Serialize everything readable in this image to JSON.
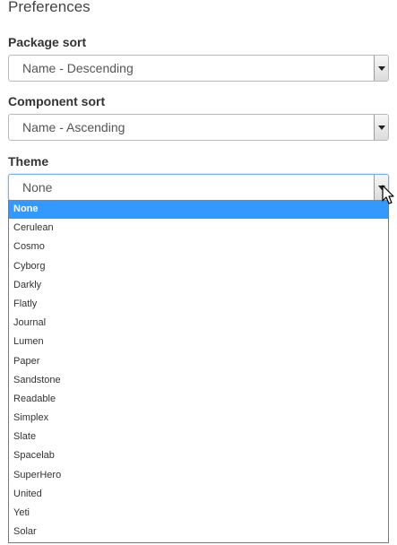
{
  "page": {
    "title": "Preferences"
  },
  "package_sort": {
    "label": "Package sort",
    "value": "Name - Descending"
  },
  "component_sort": {
    "label": "Component sort",
    "value": "Name - Ascending"
  },
  "theme": {
    "label": "Theme",
    "value": "None",
    "options": [
      "None",
      "Cerulean",
      "Cosmo",
      "Cyborg",
      "Darkly",
      "Flatly",
      "Journal",
      "Lumen",
      "Paper",
      "Sandstone",
      "Readable",
      "Simplex",
      "Slate",
      "Spacelab",
      "SuperHero",
      "United",
      "Yeti",
      "Solar"
    ],
    "selected_index": 0
  },
  "colors": {
    "selected_highlight": "#3399ff",
    "focus_border": "#7aaee8"
  },
  "icons": {
    "dropdown_arrow": "chevron-down-icon",
    "cursor": "mouse-pointer-icon"
  }
}
